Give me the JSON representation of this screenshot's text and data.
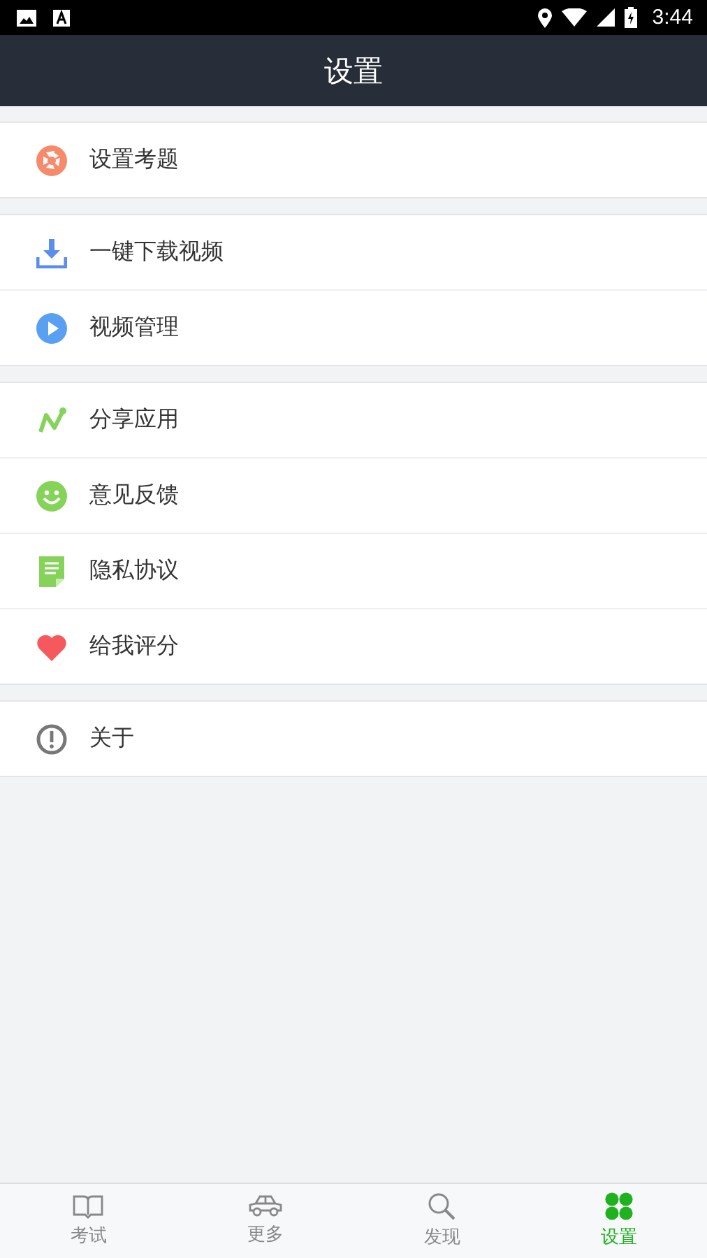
{
  "status_bar": {
    "time": "3:44"
  },
  "header": {
    "title": "设置"
  },
  "groups": [
    {
      "items": [
        {
          "label": "设置考题"
        }
      ]
    },
    {
      "items": [
        {
          "label": "一键下载视频"
        },
        {
          "label": "视频管理"
        }
      ]
    },
    {
      "items": [
        {
          "label": "分享应用"
        },
        {
          "label": "意见反馈"
        },
        {
          "label": "隐私协议"
        },
        {
          "label": "给我评分"
        }
      ]
    },
    {
      "items": [
        {
          "label": "关于"
        }
      ]
    }
  ],
  "tabs": [
    {
      "label": "考试",
      "selected": false
    },
    {
      "label": "更多",
      "selected": false
    },
    {
      "label": "发现",
      "selected": false
    },
    {
      "label": "设置",
      "selected": true
    }
  ]
}
